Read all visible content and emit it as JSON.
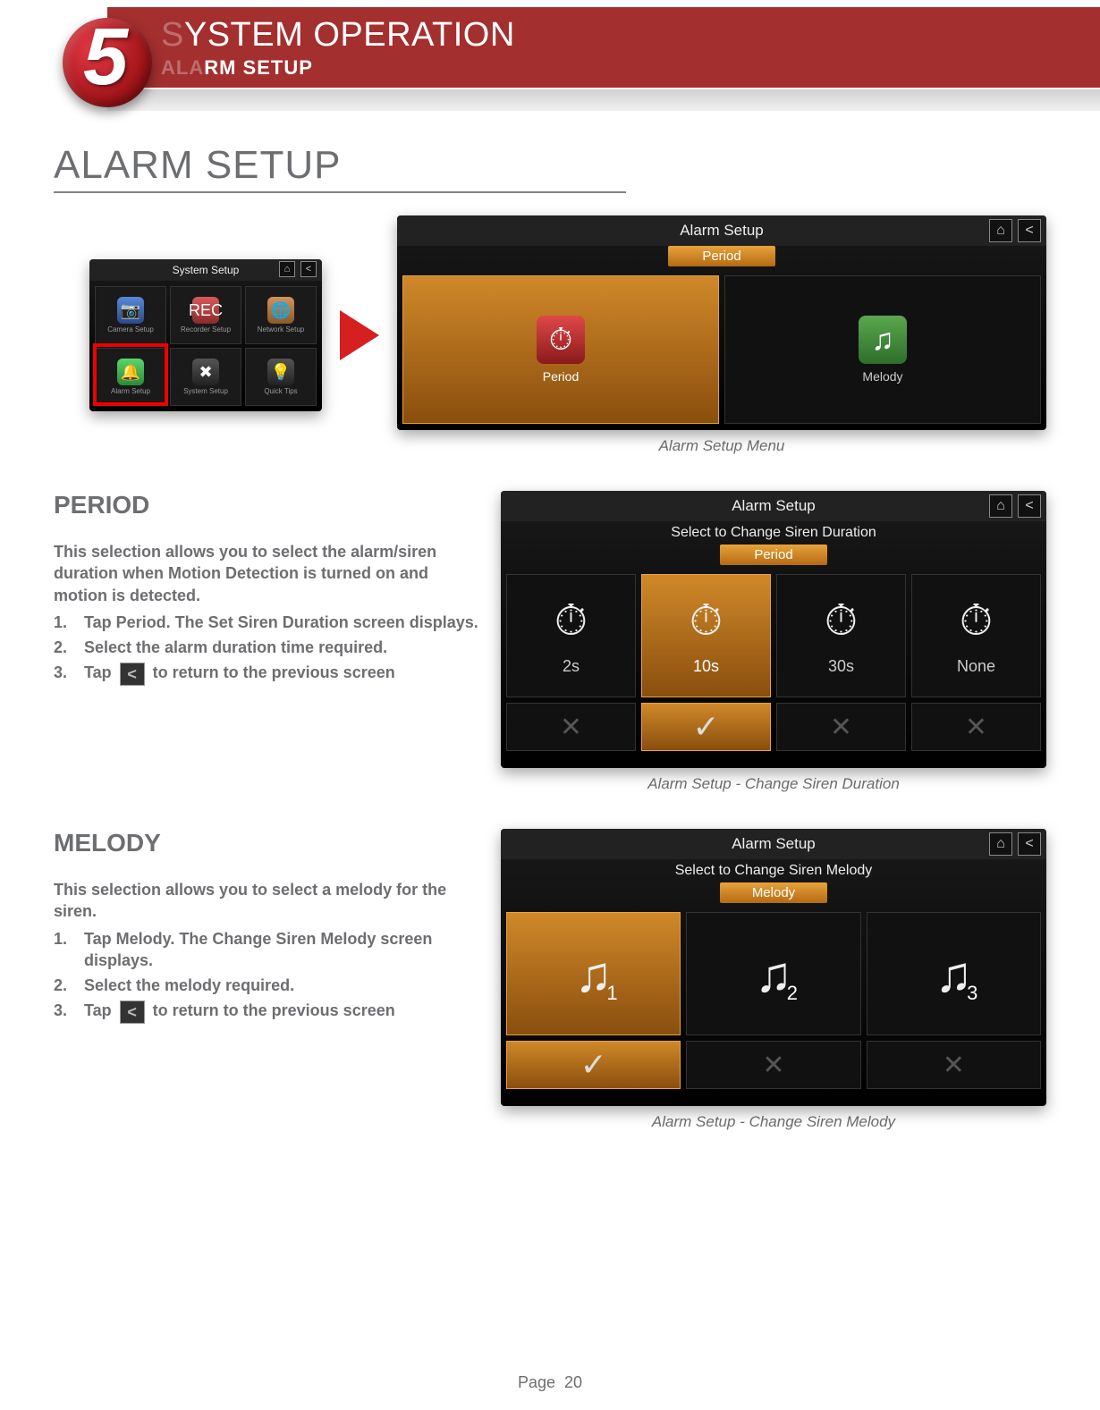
{
  "chapter": {
    "number": "5",
    "title_prefix_dim": "S",
    "title_rest": "YSTEM OPERATION",
    "sub_prefix_dim": "ALA",
    "sub_rest": "RM SETUP"
  },
  "page_title": "ALARM SETUP",
  "figure_top": {
    "small_bar": "System Setup",
    "small_items": [
      "Camera Setup",
      "Recorder Setup",
      "Network Setup",
      "Alarm Setup",
      "System Setup",
      "Quick Tips"
    ],
    "main_bar": "Alarm Setup",
    "main_tab": "Period",
    "tiles": {
      "period": "Period",
      "melody": "Melody"
    },
    "caption": "Alarm Setup Menu"
  },
  "section_period": {
    "heading": "PERIOD",
    "intro": "This selection allows you to select the alarm/siren duration when Motion Detection is turned on and motion is detected.",
    "steps": [
      "Tap Period. The Set Siren Duration screen displays.",
      "Select the alarm duration time required.",
      {
        "pre": "Tap ",
        "post": " to return to the previous screen"
      }
    ],
    "screen": {
      "bar": "Alarm Setup",
      "sub": "Select to Change Siren Duration",
      "tab": "Period",
      "options": [
        "2s",
        "10s",
        "30s",
        "None"
      ],
      "selected_index": 1
    },
    "caption": "Alarm Setup - Change Siren Duration"
  },
  "section_melody": {
    "heading": "MELODY",
    "intro": "This selection allows you to select a melody for the siren.",
    "steps": [
      "Tap Melody. The Change Siren Melody screen displays.",
      "Select the melody required.",
      {
        "pre": "Tap ",
        "post": " to return to the previous screen"
      }
    ],
    "screen": {
      "bar": "Alarm Setup",
      "sub": "Select to Change Siren Melody",
      "tab": "Melody",
      "options": [
        "1",
        "2",
        "3"
      ],
      "selected_index": 0
    },
    "caption": "Alarm Setup - Change Siren Melody"
  },
  "footer": {
    "label": "Page",
    "number": "20"
  }
}
